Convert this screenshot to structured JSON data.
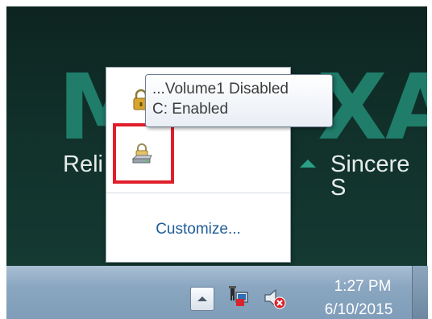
{
  "desktop": {
    "logo_letters": [
      "M",
      "X",
      "A"
    ],
    "tagline_left": "Reli",
    "tagline_right": "Sincere S"
  },
  "tooltip": {
    "line1": "...Volume1 Disabled",
    "line2": "C: Enabled"
  },
  "tray_popup": {
    "customize_label": "Customize...",
    "icons": [
      "bitlocker-lock-icon",
      "drive-lock-icon"
    ]
  },
  "taskbar": {
    "show_hidden_icons": "chevron-up-icon",
    "tray_icons": [
      "network-icon",
      "volume-muted-icon"
    ],
    "clock": {
      "time": "1:27 PM",
      "date": "6/10/2015"
    }
  },
  "colors": {
    "highlight": "#e01e2a",
    "link": "#1e5d98",
    "brand_green": "#1f7d6a"
  }
}
